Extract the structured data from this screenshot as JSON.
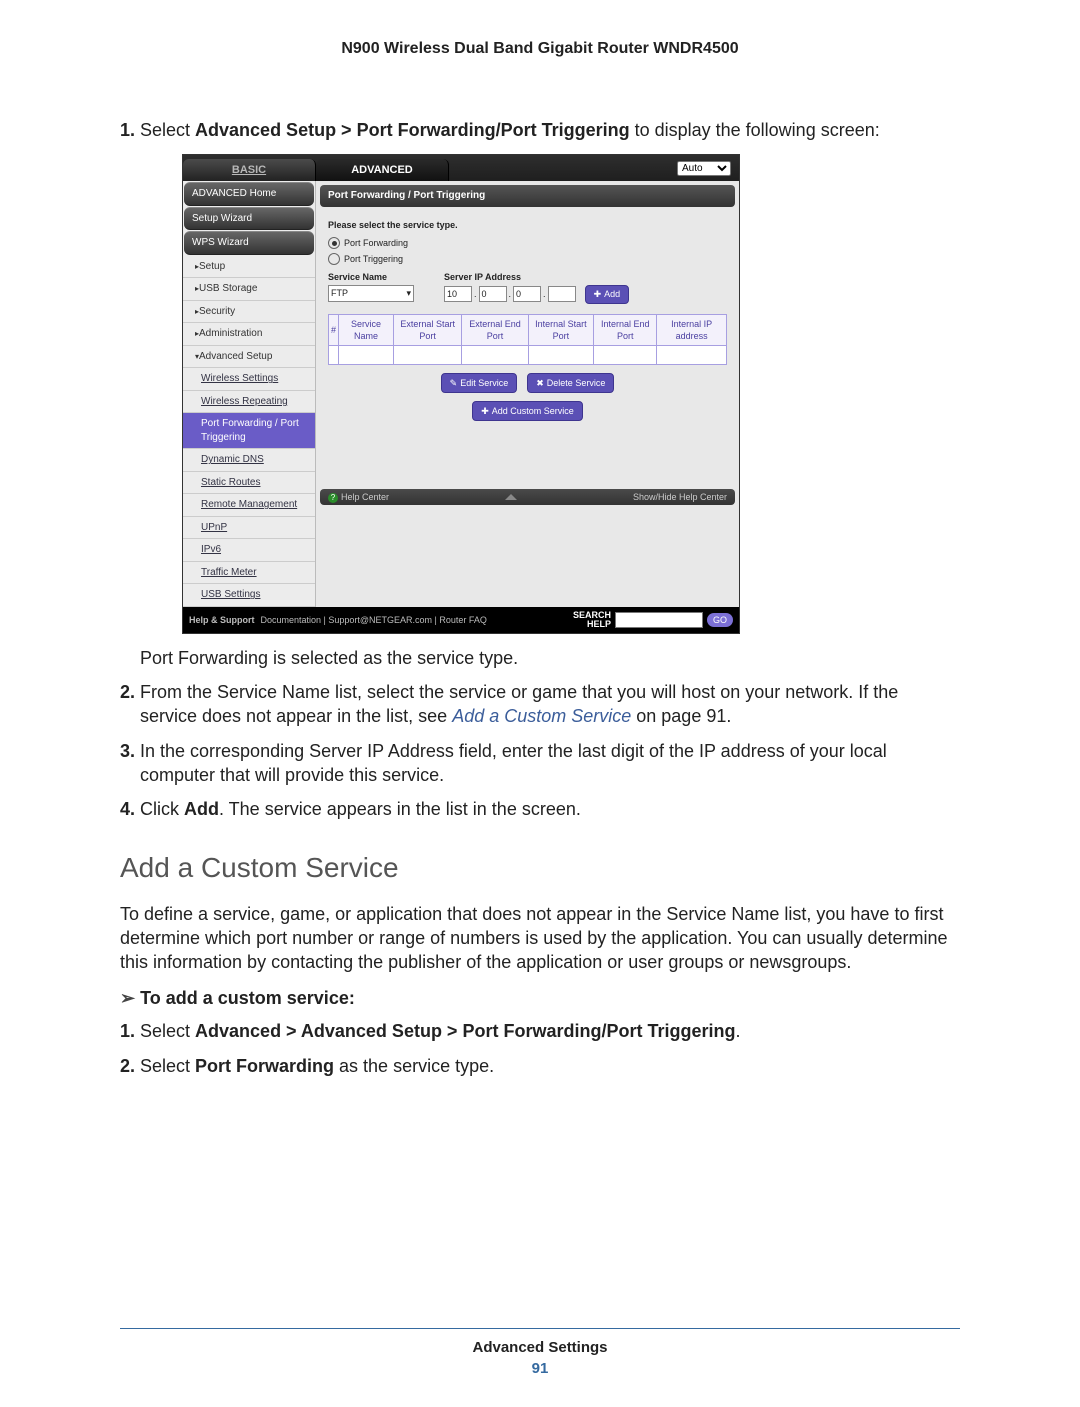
{
  "doc": {
    "title": "N900 Wireless Dual Band Gigabit Router WNDR4500",
    "footer_section": "Advanced Settings",
    "page_number": "91"
  },
  "instructions_a": {
    "step1_pre": "Select ",
    "step1_bold": "Advanced Setup > Port Forwarding/Port Triggering",
    "step1_post": " to display the following screen:",
    "after_screenshot": "Port Forwarding is selected as the service type.",
    "step2_pre": "From the Service Name list, select the service or game that you will host on your network. If the service does not appear in the list, see ",
    "step2_link": "Add a Custom Service",
    "step2_post": " on page 91.",
    "step3": "In the corresponding Server IP Address field, enter the last digit of the IP address of your local computer that will provide this service.",
    "step4_pre": "Click ",
    "step4_bold": "Add",
    "step4_post": ". The service appears in the list in the screen."
  },
  "section_heading": "Add a Custom Service",
  "section_body": "To define a service, game, or application that does not appear in the Service Name list, you have to first determine which port number or range of numbers is used by the application. You can usually determine this information by contacting the publisher of the application or user groups or newsgroups.",
  "task_heading": "To add a custom service:",
  "instructions_b": {
    "step1_pre": "Select ",
    "step1_bold": "Advanced > Advanced Setup > Port Forwarding/Port Triggering",
    "step1_post": ".",
    "step2_pre": "Select ",
    "step2_bold": "Port Forwarding",
    "step2_post": " as the service type."
  },
  "ui": {
    "tabs": {
      "basic": "BASIC",
      "advanced": "ADVANCED",
      "auto": "Auto"
    },
    "sidebar": {
      "home": "ADVANCED Home",
      "setup_wizard": "Setup Wizard",
      "wps": "WPS Wizard",
      "setup": "Setup",
      "usb": "USB Storage",
      "security": "Security",
      "admin": "Administration",
      "adv_setup": "Advanced Setup",
      "sub": {
        "wireless_settings": "Wireless Settings",
        "wireless_repeating": "Wireless Repeating",
        "pf": "Port Forwarding / Port Triggering",
        "ddns": "Dynamic DNS",
        "static": "Static Routes",
        "remote": "Remote Management",
        "upnp": "UPnP",
        "ipv6": "IPv6",
        "traffic": "Traffic Meter",
        "usb_set": "USB Settings"
      }
    },
    "content": {
      "heading": "Port Forwarding / Port Triggering",
      "prompt": "Please select the service type.",
      "radio_pf": "Port Forwarding",
      "radio_pt": "Port Triggering",
      "service_name_label": "Service Name",
      "service_name_value": "FTP",
      "server_ip_label": "Server IP Address",
      "ip": [
        "10",
        "0",
        "0",
        ""
      ],
      "add_btn": "Add",
      "columns": [
        "#",
        "Service Name",
        "External Start Port",
        "External End Port",
        "Internal Start Port",
        "Internal End Port",
        "Internal IP address"
      ],
      "edit_btn": "Edit Service",
      "delete_btn": "Delete Service",
      "add_custom_btn": "Add Custom Service",
      "help_center": "Help Center",
      "show_hide": "Show/Hide Help Center"
    },
    "footer": {
      "help_support": "Help & Support",
      "links": "Documentation  |  Support@NETGEAR.com  |  Router FAQ",
      "search_label1": "SEARCH",
      "search_label2": "HELP",
      "go": "GO"
    }
  }
}
